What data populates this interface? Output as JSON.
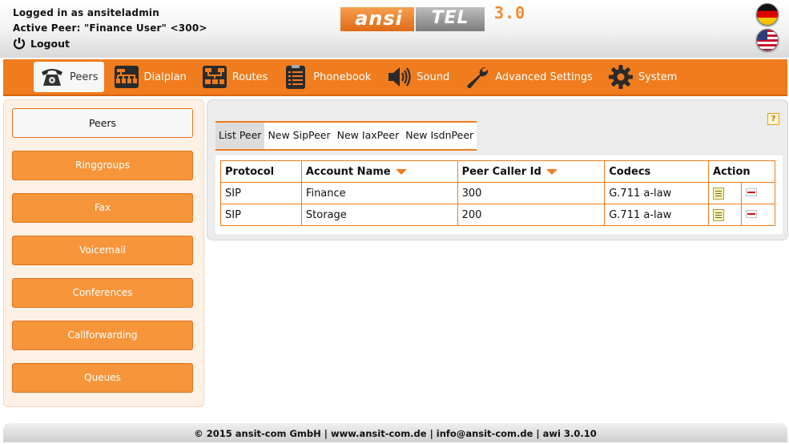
{
  "header": {
    "logged_in": "Logged in as ansiteladmin",
    "active_peer": "Active Peer: \"Finance User\" <300>",
    "logout": "Logout",
    "logo_part1": "ansi",
    "logo_part2": "TEL",
    "logo_version": "3.0",
    "languages": [
      {
        "flag": "de-flag-icon"
      },
      {
        "flag": "us-flag-icon"
      }
    ]
  },
  "nav": {
    "items": [
      {
        "label": "Peers",
        "icon": "phone-icon"
      },
      {
        "label": "Dialplan",
        "icon": "dialplan-icon"
      },
      {
        "label": "Routes",
        "icon": "routes-icon"
      },
      {
        "label": "Phonebook",
        "icon": "phonebook-icon"
      },
      {
        "label": "Sound",
        "icon": "speaker-icon"
      },
      {
        "label": "Advanced Settings",
        "icon": "wrench-icon"
      },
      {
        "label": "System",
        "icon": "gear-icon"
      }
    ]
  },
  "sidebar": {
    "items": [
      {
        "label": "Peers"
      },
      {
        "label": "Ringgroups"
      },
      {
        "label": "Fax"
      },
      {
        "label": "Voicemail"
      },
      {
        "label": "Conferences"
      },
      {
        "label": "Callforwarding"
      },
      {
        "label": "Queues"
      }
    ]
  },
  "main": {
    "help": "?",
    "tabs": [
      {
        "label": "List Peer"
      },
      {
        "label": "New SipPeer"
      },
      {
        "label": "New IaxPeer"
      },
      {
        "label": "New IsdnPeer"
      }
    ],
    "table": {
      "headers": [
        "Protocol",
        "Account Name",
        "Peer Caller Id",
        "Codecs",
        "Action"
      ],
      "rows": [
        {
          "protocol": "SIP",
          "account": "Finance",
          "caller_id": "300",
          "codecs": "G.711 a-law"
        },
        {
          "protocol": "SIP",
          "account": "Storage",
          "caller_id": "200",
          "codecs": "G.711 a-law"
        }
      ]
    }
  },
  "footer": {
    "text": "© 2015 ansit-com GmbH | www.ansit-com.de | info@ansit-com.de | awi 3.0.10"
  },
  "colors": {
    "accent": "#f07c1e",
    "sidebar_button": "#f7953a"
  }
}
